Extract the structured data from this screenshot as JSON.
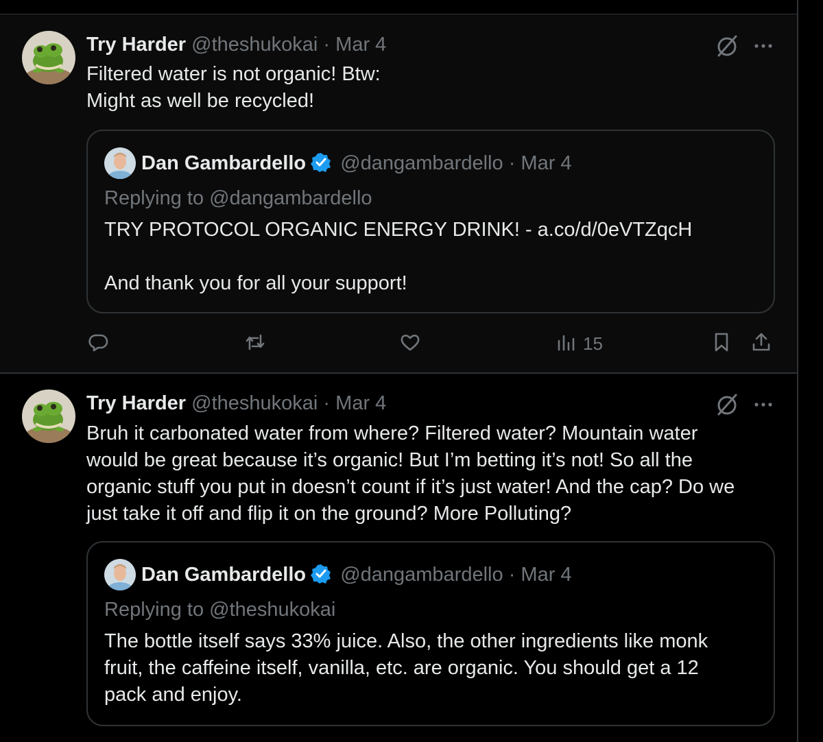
{
  "tweets": [
    {
      "author_name": "Try Harder",
      "author_handle": "@theshukokai",
      "separator": "·",
      "date": "Mar 4",
      "text_lines": [
        "Filtered water is not organic! Btw:",
        "Might as well be recycled!"
      ],
      "quote": {
        "author_name": "Dan Gambardello",
        "author_handle": "@dangambardello",
        "separator": "·",
        "date": "Mar 4",
        "replying": "Replying to @dangambardello",
        "text_lines": [
          "TRY PROTOCOL ORGANIC ENERGY DRINK! - a.co/d/0eVTZqcH",
          "And thank you for all your support!"
        ]
      },
      "actions": {
        "views": "15"
      }
    },
    {
      "author_name": "Try Harder",
      "author_handle": "@theshukokai",
      "separator": "·",
      "date": "Mar 4",
      "text_lines": [
        "Bruh it carbonated water from where?  Filtered water? Mountain water",
        "would be great because it’s organic! But I’m betting it’s not! So all the",
        "organic stuff you put in doesn’t count if it’s just water! And the cap? Do we",
        "just take it off and flip it on the ground? More Polluting?"
      ],
      "quote": {
        "author_name": "Dan Gambardello",
        "author_handle": "@dangambardello",
        "separator": "·",
        "date": "Mar 4",
        "replying": "Replying to @theshukokai",
        "text_lines": [
          "The bottle itself says 33% juice. Also, the other ingredients like monk",
          "fruit, the caffeine itself, vanilla, etc. are organic. You should get a 12",
          "pack and enjoy."
        ]
      }
    }
  ],
  "icons": {
    "verified": "verified-badge-icon",
    "grok": "grok-icon",
    "more": "more-icon",
    "reply": "reply-icon",
    "retweet": "retweet-icon",
    "like": "heart-icon",
    "views": "views-icon",
    "bookmark": "bookmark-icon",
    "share": "share-icon"
  },
  "colors": {
    "background": "#000000",
    "text": "#e7e9ea",
    "secondary": "#71767b",
    "border": "#2f3336",
    "verified": "#1d9bf0"
  }
}
